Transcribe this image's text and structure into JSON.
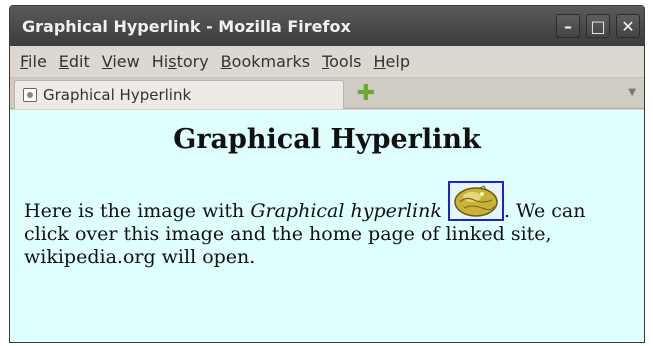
{
  "window": {
    "title": "Graphical Hyperlink - Mozilla Firefox",
    "controls": {
      "minimize": "–",
      "maximize": "□",
      "close": "✕"
    }
  },
  "menubar": {
    "items": [
      {
        "pre": "",
        "ul": "F",
        "post": "ile"
      },
      {
        "pre": "",
        "ul": "E",
        "post": "dit"
      },
      {
        "pre": "",
        "ul": "V",
        "post": "iew"
      },
      {
        "pre": "Hi",
        "ul": "s",
        "post": "tory"
      },
      {
        "pre": "",
        "ul": "B",
        "post": "ookmarks"
      },
      {
        "pre": "",
        "ul": "T",
        "post": "ools"
      },
      {
        "pre": "",
        "ul": "H",
        "post": "elp"
      }
    ]
  },
  "tabs": {
    "active": "Graphical Hyperlink",
    "new_tab_icon": "plus-icon",
    "overflow_icon": "▼"
  },
  "page": {
    "heading": "Graphical Hyperlink",
    "text_before": "Here is the image with ",
    "text_italic": "Graphical hyperlink",
    "text_after": ". We can click over this image and the home page of linked site, wikipedia.org will open.",
    "image_icon": "wikipedia-globe-icon"
  },
  "colors": {
    "content_bg": "#dfffff",
    "titlebar_bg": "#3c3c3c",
    "link_border": "#2222cc"
  }
}
